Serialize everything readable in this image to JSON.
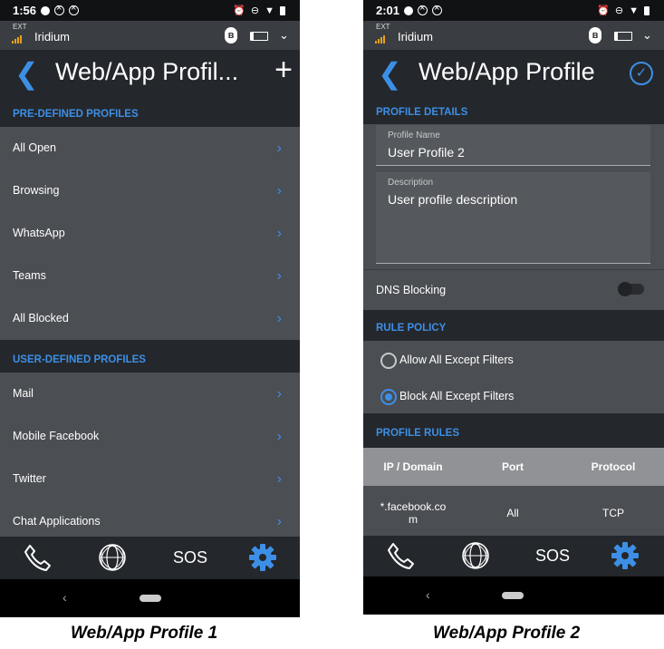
{
  "colors": {
    "accent": "#3d8fe6",
    "background": "#4b4e52",
    "header": "#24272b",
    "signal": "#e7a11a"
  },
  "screen1": {
    "status_time": "1:56",
    "device_ext": "EXT",
    "device_name": "Iridium",
    "title": "Web/App Profil...",
    "predefined_header": "PRE-DEFINED PROFILES",
    "predefined": [
      "All Open",
      "Browsing",
      "WhatsApp",
      "Teams",
      "All Blocked"
    ],
    "userdefined_header": "USER-DEFINED PROFILES",
    "userdefined": [
      "Mail",
      "Mobile Facebook",
      "Twitter",
      "Chat Applications"
    ],
    "nav": {
      "phone_icon": "phone-icon",
      "globe_icon": "globe-icon",
      "sos_label": "SOS",
      "settings_icon": "gear-icon"
    },
    "caption": "Web/App Profile 1"
  },
  "screen2": {
    "status_time": "2:01",
    "device_ext": "EXT",
    "device_name": "Iridium",
    "title": "Web/App Profile",
    "details_header": "PROFILE DETAILS",
    "profile_name_label": "Profile Name",
    "profile_name_value": "User Profile 2",
    "description_label": "Description",
    "description_value": "User profile description",
    "dns_label": "DNS Blocking",
    "dns_enabled": false,
    "rule_policy_header": "RULE POLICY",
    "policies": [
      {
        "label": "Allow All Except Filters",
        "selected": false
      },
      {
        "label": "Block All Except Filters",
        "selected": true
      }
    ],
    "rules_header": "PROFILE RULES",
    "columns": [
      "IP / Domain",
      "Port",
      "Protocol"
    ],
    "rules": [
      {
        "domain_line1": "*.facebook.co",
        "domain_line2": "m",
        "port": "All",
        "protocol": "TCP"
      }
    ],
    "nav": {
      "phone_icon": "phone-icon",
      "globe_icon": "globe-icon",
      "sos_label": "SOS",
      "settings_icon": "gear-icon"
    },
    "caption": "Web/App Profile 2"
  }
}
